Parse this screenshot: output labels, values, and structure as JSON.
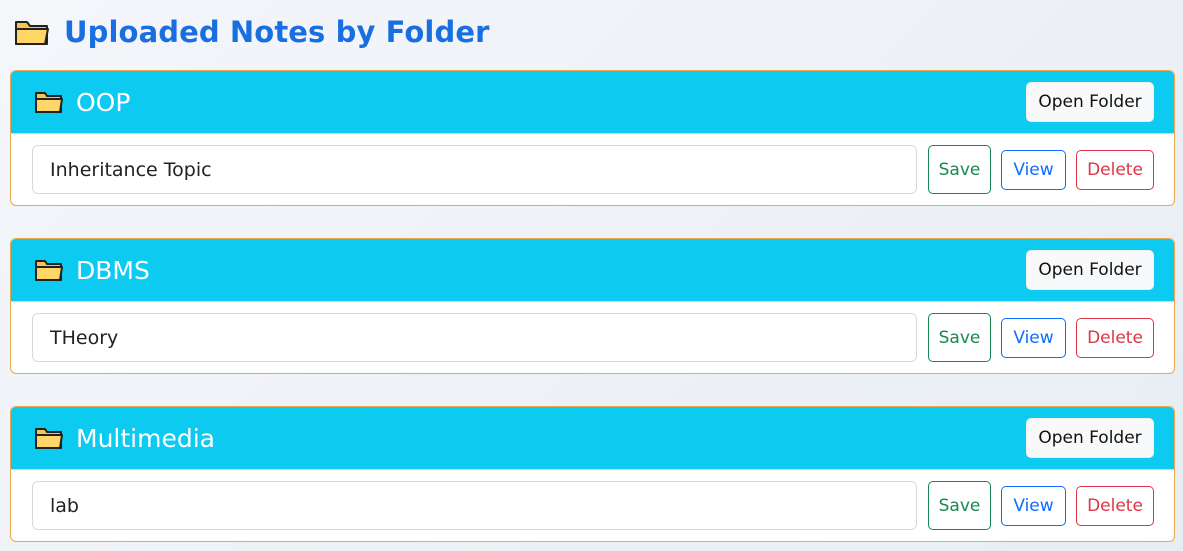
{
  "page": {
    "title": "Uploaded Notes by Folder",
    "title_icon": "folder-icon"
  },
  "buttons": {
    "open_folder": "Open Folder",
    "save": "Save",
    "view": "View",
    "delete": "Delete"
  },
  "folders": [
    {
      "name": "OOP",
      "note": "Inheritance Topic"
    },
    {
      "name": "DBMS",
      "note": "THeory"
    },
    {
      "name": "Multimedia",
      "note": "lab"
    }
  ],
  "colors": {
    "header_bg": "#0dcaf0",
    "title_color": "#1a6fe0",
    "save": "#198754",
    "view": "#0d6efd",
    "delete": "#dc3545",
    "card_border": "#e9a94d"
  }
}
